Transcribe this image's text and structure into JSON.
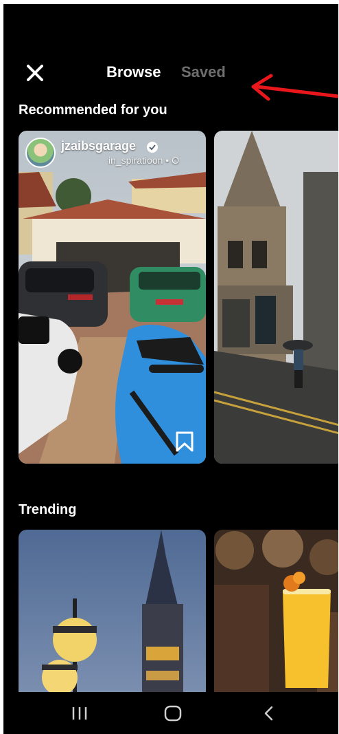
{
  "header": {
    "tabs": [
      {
        "label": "Browse",
        "active": true
      },
      {
        "label": "Saved",
        "active": false
      }
    ],
    "close_icon": "close-icon",
    "annotation_color": "#e8171b"
  },
  "sections": [
    {
      "title": "Recommended for you",
      "cards": [
        {
          "author": "jzaibsgarage",
          "verified": true,
          "subline": "in_spiratioon • O",
          "image": "garage-with-sports-cars",
          "icon": "bookmark-icon"
        },
        {
          "image": "old-town-street-building"
        }
      ]
    },
    {
      "title": "Trending",
      "cards": [
        {
          "image": "big-ben-with-street-lamps"
        },
        {
          "image": "orange-cocktail-glass"
        }
      ]
    }
  ],
  "navbar": {
    "items": [
      "recent-apps-icon",
      "home-icon",
      "back-icon"
    ]
  }
}
